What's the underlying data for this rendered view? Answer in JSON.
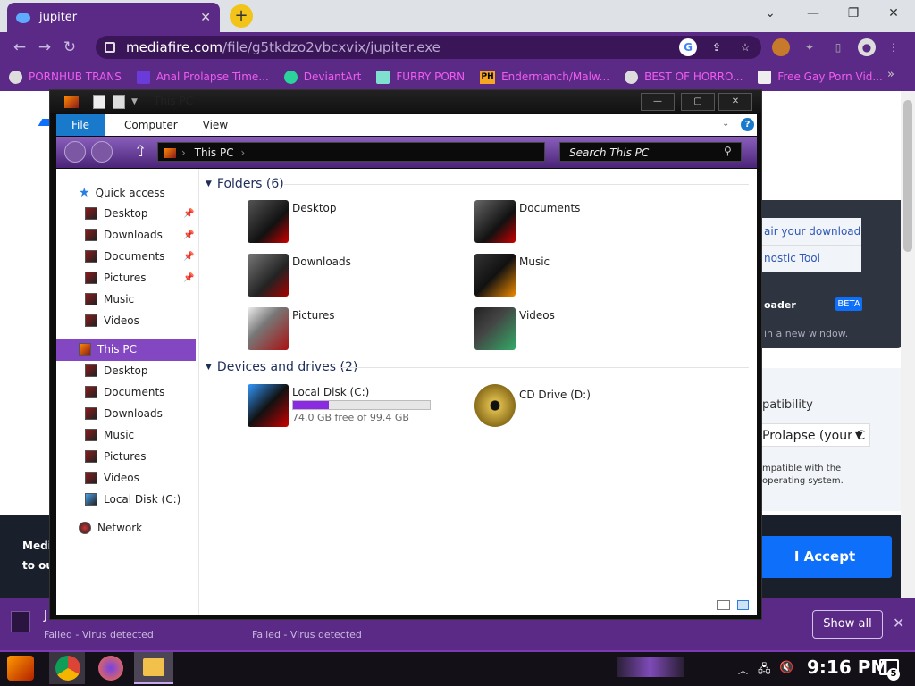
{
  "browser": {
    "tab_title": "jupiter",
    "tab_close": "✕",
    "new_tab": "+",
    "url_domain": "mediafire.com",
    "url_path": "/file/g5tkdzo2vbcxvix/jupiter.exe",
    "bookmarks": [
      {
        "label": "PORNHUB TRANS"
      },
      {
        "label": "Anal Prolapse Time..."
      },
      {
        "label": "DeviantArt"
      },
      {
        "label": "FURRY PORN"
      },
      {
        "label": "Endermanch/Malw..."
      },
      {
        "label": "BEST OF HORRO..."
      },
      {
        "label": "Free Gay Porn Vid..."
      }
    ],
    "bookmarks_more": "»",
    "ph_badge": "PH"
  },
  "webpage": {
    "repair_link": "air your download",
    "diag_link": "nostic Tool",
    "loader_label": "oader",
    "beta_badge": "BETA",
    "new_window": "in a new window.",
    "compat_label": "patibility",
    "compat_select": "Prolapse (your C",
    "compat_note_1": "mpatible with the",
    "compat_note_2": "operating system.",
    "cookie_text_1": "Medi",
    "cookie_text_2": "to ou",
    "accept_button": "I Accept"
  },
  "downloads": {
    "item1_name": "J",
    "item1_status": "Failed - Virus detected",
    "item2_status": "Failed - Virus detected",
    "show_all": "Show all"
  },
  "taskbar": {
    "clock": "9:16 PM",
    "notif_count": "5"
  },
  "explorer": {
    "title": "This PC",
    "ribbon_file": "File",
    "ribbon_tabs": [
      "Computer",
      "View"
    ],
    "help": "?",
    "addr_path": "This PC",
    "search_placeholder": "Search This PC",
    "btn_min": "—",
    "btn_max": "▢",
    "btn_close": "✕",
    "nav": {
      "quick_access": "Quick access",
      "qa_items": [
        "Desktop",
        "Downloads",
        "Documents",
        "Pictures",
        "Music",
        "Videos"
      ],
      "this_pc": "This PC",
      "pc_items": [
        "Desktop",
        "Documents",
        "Downloads",
        "Music",
        "Pictures",
        "Videos",
        "Local Disk (C:)"
      ],
      "network": "Network"
    },
    "folders_header": "Folders (6)",
    "folders": [
      "Desktop",
      "Documents",
      "Downloads",
      "Music",
      "Pictures",
      "Videos"
    ],
    "drives_header": "Devices and drives (2)",
    "drive_c": {
      "name": "Local Disk (C:)",
      "free": "74.0 GB free of 99.4 GB",
      "used_fraction": 0.26
    },
    "drive_d": {
      "name": "CD Drive (D:)"
    }
  },
  "colors": {
    "accent_purple": "#5b2a86",
    "selection": "#8347c2",
    "mf_blue": "#0e6ffb"
  }
}
